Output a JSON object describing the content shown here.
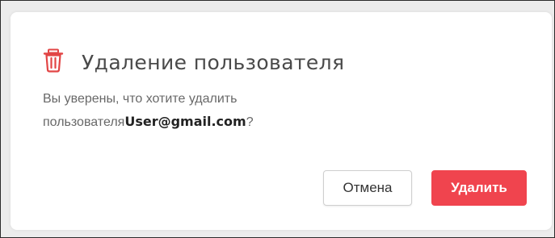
{
  "dialog": {
    "title": "Удаление пользователя",
    "icon": "trash-icon",
    "message_prefix_line1": "Вы уверены, что хотите удалить",
    "message_prefix_line2": "пользователя",
    "email": "User@gmail.com",
    "message_suffix": "?",
    "cancel_label": "Отмена",
    "delete_label": "Удалить"
  },
  "colors": {
    "danger": "#f0444e",
    "icon": "#e24545",
    "text": "#4a4a4a",
    "muted_text": "#686868"
  }
}
